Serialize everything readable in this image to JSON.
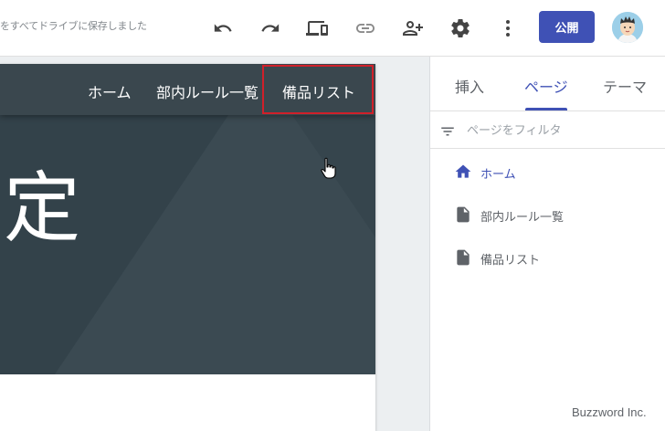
{
  "toolbar": {
    "save_status": "をすべてドライブに保存しました",
    "icons": [
      "undo-icon",
      "redo-icon",
      "device-preview-icon",
      "link-icon",
      "add-person-icon",
      "gear-icon",
      "more-vert-icon"
    ],
    "publish_label": "公開",
    "accent_color": "#3f51b5"
  },
  "site": {
    "nav": [
      "ホーム",
      "部内ルール一覧",
      "備品リスト"
    ],
    "hero_title": "定",
    "hero_color": "#37474f",
    "highlight_color": "#d0202a"
  },
  "panel": {
    "tabs": [
      "挿入",
      "ページ",
      "テーマ"
    ],
    "active_tab": "ページ",
    "filter_placeholder": "ページをフィルタ",
    "pages": [
      {
        "label": "ホーム",
        "icon": "home-icon",
        "active": true
      },
      {
        "label": "部内ルール一覧",
        "icon": "page-icon",
        "active": false
      },
      {
        "label": "備品リスト",
        "icon": "page-icon",
        "active": false
      }
    ]
  },
  "watermark": "Buzzword Inc."
}
